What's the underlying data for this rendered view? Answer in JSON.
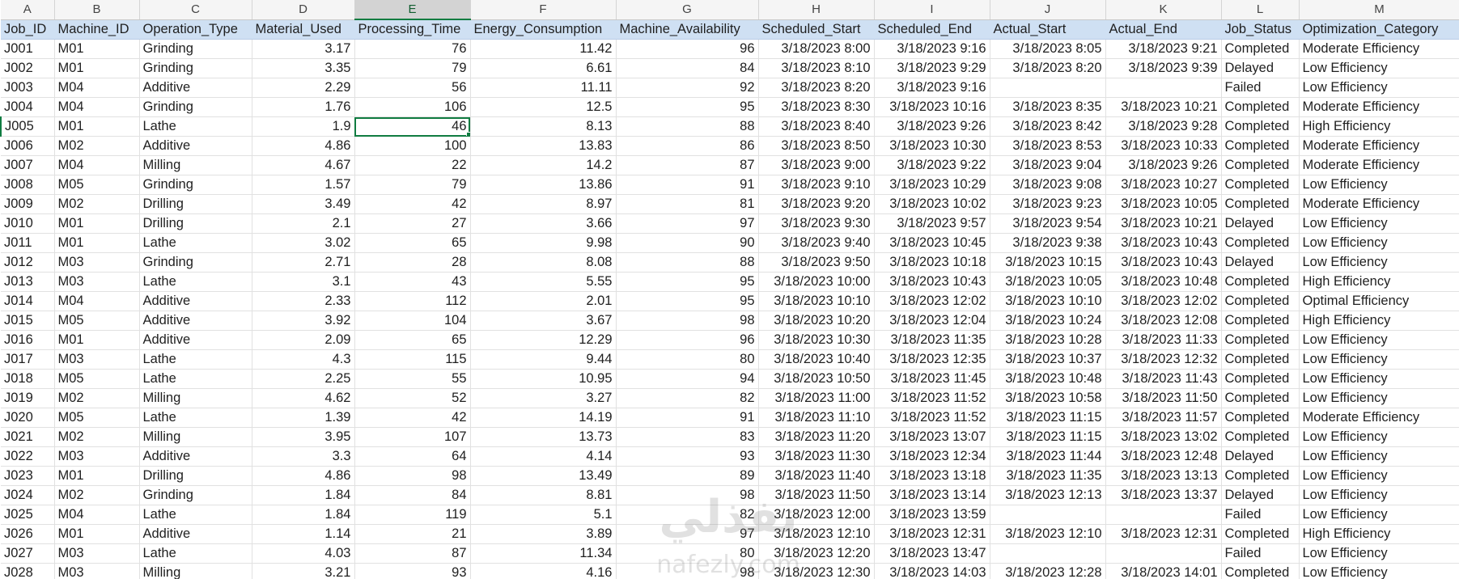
{
  "column_letters": [
    "A",
    "B",
    "C",
    "D",
    "E",
    "F",
    "G",
    "H",
    "I",
    "J",
    "K",
    "L",
    "M"
  ],
  "active_column": "E",
  "headers": [
    "Job_ID",
    "Machine_ID",
    "Operation_Type",
    "Material_Used",
    "Processing_Time",
    "Energy_Consumption",
    "Machine_Availability",
    "Scheduled_Start",
    "Scheduled_End",
    "Actual_Start",
    "Actual_End",
    "Job_Status",
    "Optimization_Category"
  ],
  "active_cell": {
    "row": 4,
    "col": 4
  },
  "rows": [
    [
      "J001",
      "M01",
      "Grinding",
      "3.17",
      "76",
      "11.42",
      "96",
      "3/18/2023 8:00",
      "3/18/2023 9:16",
      "3/18/2023 8:05",
      "3/18/2023 9:21",
      "Completed",
      "Moderate Efficiency"
    ],
    [
      "J002",
      "M01",
      "Grinding",
      "3.35",
      "79",
      "6.61",
      "84",
      "3/18/2023 8:10",
      "3/18/2023 9:29",
      "3/18/2023 8:20",
      "3/18/2023 9:39",
      "Delayed",
      "Low Efficiency"
    ],
    [
      "J003",
      "M04",
      "Additive",
      "2.29",
      "56",
      "11.11",
      "92",
      "3/18/2023 8:20",
      "3/18/2023 9:16",
      "",
      "",
      "Failed",
      "Low Efficiency"
    ],
    [
      "J004",
      "M04",
      "Grinding",
      "1.76",
      "106",
      "12.5",
      "95",
      "3/18/2023 8:30",
      "3/18/2023 10:16",
      "3/18/2023 8:35",
      "3/18/2023 10:21",
      "Completed",
      "Moderate Efficiency"
    ],
    [
      "J005",
      "M01",
      "Lathe",
      "1.9",
      "46",
      "8.13",
      "88",
      "3/18/2023 8:40",
      "3/18/2023 9:26",
      "3/18/2023 8:42",
      "3/18/2023 9:28",
      "Completed",
      "High Efficiency"
    ],
    [
      "J006",
      "M02",
      "Additive",
      "4.86",
      "100",
      "13.83",
      "86",
      "3/18/2023 8:50",
      "3/18/2023 10:30",
      "3/18/2023 8:53",
      "3/18/2023 10:33",
      "Completed",
      "Moderate Efficiency"
    ],
    [
      "J007",
      "M04",
      "Milling",
      "4.67",
      "22",
      "14.2",
      "87",
      "3/18/2023 9:00",
      "3/18/2023 9:22",
      "3/18/2023 9:04",
      "3/18/2023 9:26",
      "Completed",
      "Moderate Efficiency"
    ],
    [
      "J008",
      "M05",
      "Grinding",
      "1.57",
      "79",
      "13.86",
      "91",
      "3/18/2023 9:10",
      "3/18/2023 10:29",
      "3/18/2023 9:08",
      "3/18/2023 10:27",
      "Completed",
      "Low Efficiency"
    ],
    [
      "J009",
      "M02",
      "Drilling",
      "3.49",
      "42",
      "8.97",
      "81",
      "3/18/2023 9:20",
      "3/18/2023 10:02",
      "3/18/2023 9:23",
      "3/18/2023 10:05",
      "Completed",
      "Moderate Efficiency"
    ],
    [
      "J010",
      "M01",
      "Drilling",
      "2.1",
      "27",
      "3.66",
      "97",
      "3/18/2023 9:30",
      "3/18/2023 9:57",
      "3/18/2023 9:54",
      "3/18/2023 10:21",
      "Delayed",
      "Low Efficiency"
    ],
    [
      "J011",
      "M01",
      "Lathe",
      "3.02",
      "65",
      "9.98",
      "90",
      "3/18/2023 9:40",
      "3/18/2023 10:45",
      "3/18/2023 9:38",
      "3/18/2023 10:43",
      "Completed",
      "Low Efficiency"
    ],
    [
      "J012",
      "M03",
      "Grinding",
      "2.71",
      "28",
      "8.08",
      "88",
      "3/18/2023 9:50",
      "3/18/2023 10:18",
      "3/18/2023 10:15",
      "3/18/2023 10:43",
      "Delayed",
      "Low Efficiency"
    ],
    [
      "J013",
      "M03",
      "Lathe",
      "3.1",
      "43",
      "5.55",
      "95",
      "3/18/2023 10:00",
      "3/18/2023 10:43",
      "3/18/2023 10:05",
      "3/18/2023 10:48",
      "Completed",
      "High Efficiency"
    ],
    [
      "J014",
      "M04",
      "Additive",
      "2.33",
      "112",
      "2.01",
      "95",
      "3/18/2023 10:10",
      "3/18/2023 12:02",
      "3/18/2023 10:10",
      "3/18/2023 12:02",
      "Completed",
      "Optimal Efficiency"
    ],
    [
      "J015",
      "M05",
      "Additive",
      "3.92",
      "104",
      "3.67",
      "98",
      "3/18/2023 10:20",
      "3/18/2023 12:04",
      "3/18/2023 10:24",
      "3/18/2023 12:08",
      "Completed",
      "High Efficiency"
    ],
    [
      "J016",
      "M01",
      "Additive",
      "2.09",
      "65",
      "12.29",
      "96",
      "3/18/2023 10:30",
      "3/18/2023 11:35",
      "3/18/2023 10:28",
      "3/18/2023 11:33",
      "Completed",
      "Low Efficiency"
    ],
    [
      "J017",
      "M03",
      "Lathe",
      "4.3",
      "115",
      "9.44",
      "80",
      "3/18/2023 10:40",
      "3/18/2023 12:35",
      "3/18/2023 10:37",
      "3/18/2023 12:32",
      "Completed",
      "Low Efficiency"
    ],
    [
      "J018",
      "M05",
      "Lathe",
      "2.25",
      "55",
      "10.95",
      "94",
      "3/18/2023 10:50",
      "3/18/2023 11:45",
      "3/18/2023 10:48",
      "3/18/2023 11:43",
      "Completed",
      "Low Efficiency"
    ],
    [
      "J019",
      "M02",
      "Milling",
      "4.62",
      "52",
      "3.27",
      "82",
      "3/18/2023 11:00",
      "3/18/2023 11:52",
      "3/18/2023 10:58",
      "3/18/2023 11:50",
      "Completed",
      "Low Efficiency"
    ],
    [
      "J020",
      "M05",
      "Lathe",
      "1.39",
      "42",
      "14.19",
      "91",
      "3/18/2023 11:10",
      "3/18/2023 11:52",
      "3/18/2023 11:15",
      "3/18/2023 11:57",
      "Completed",
      "Moderate Efficiency"
    ],
    [
      "J021",
      "M02",
      "Milling",
      "3.95",
      "107",
      "13.73",
      "83",
      "3/18/2023 11:20",
      "3/18/2023 13:07",
      "3/18/2023 11:15",
      "3/18/2023 13:02",
      "Completed",
      "Low Efficiency"
    ],
    [
      "J022",
      "M03",
      "Additive",
      "3.3",
      "64",
      "4.14",
      "93",
      "3/18/2023 11:30",
      "3/18/2023 12:34",
      "3/18/2023 11:44",
      "3/18/2023 12:48",
      "Delayed",
      "Low Efficiency"
    ],
    [
      "J023",
      "M01",
      "Drilling",
      "4.86",
      "98",
      "13.49",
      "89",
      "3/18/2023 11:40",
      "3/18/2023 13:18",
      "3/18/2023 11:35",
      "3/18/2023 13:13",
      "Completed",
      "Low Efficiency"
    ],
    [
      "J024",
      "M02",
      "Grinding",
      "1.84",
      "84",
      "8.81",
      "98",
      "3/18/2023 11:50",
      "3/18/2023 13:14",
      "3/18/2023 12:13",
      "3/18/2023 13:37",
      "Delayed",
      "Low Efficiency"
    ],
    [
      "J025",
      "M04",
      "Lathe",
      "1.84",
      "119",
      "5.1",
      "82",
      "3/18/2023 12:00",
      "3/18/2023 13:59",
      "",
      "",
      "Failed",
      "Low Efficiency"
    ],
    [
      "J026",
      "M01",
      "Additive",
      "1.14",
      "21",
      "3.89",
      "97",
      "3/18/2023 12:10",
      "3/18/2023 12:31",
      "3/18/2023 12:10",
      "3/18/2023 12:31",
      "Completed",
      "High Efficiency"
    ],
    [
      "J027",
      "M03",
      "Lathe",
      "4.03",
      "87",
      "11.34",
      "80",
      "3/18/2023 12:20",
      "3/18/2023 13:47",
      "",
      "",
      "Failed",
      "Low Efficiency"
    ],
    [
      "J028",
      "M03",
      "Milling",
      "3.21",
      "93",
      "4.16",
      "98",
      "3/18/2023 12:30",
      "3/18/2023 14:03",
      "3/18/2023 12:28",
      "3/18/2023 14:01",
      "Completed",
      "Low Efficiency"
    ]
  ],
  "numeric_columns": [
    3,
    4,
    5,
    6,
    7,
    8,
    9,
    10
  ],
  "watermark": {
    "text_arabic": "نفذلي",
    "text_latin": "nafezly.com"
  }
}
